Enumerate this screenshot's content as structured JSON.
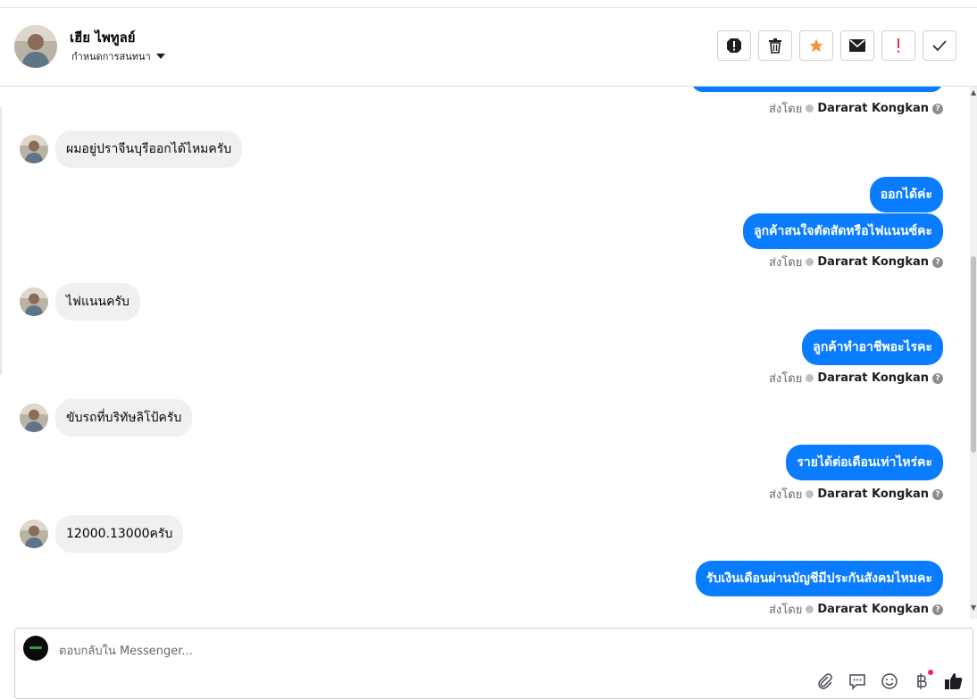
{
  "header": {
    "name": "เฮีย ไพทูลย์",
    "assign_label": "กำหนดการสนทนา",
    "actions": [
      "spam-alert-icon",
      "trash-icon",
      "star-icon",
      "envelope-icon",
      "important-icon",
      "check-icon"
    ]
  },
  "colors": {
    "accent": "#0a7cff",
    "star": "#f7923a",
    "important": "#f02849"
  },
  "messages": {
    "in1": "ผมอยู่ปราจีนบุรีออกได้ไหมครับ",
    "in2": "ไฟแนนครับ",
    "in3": "ขับรถที่บริทัษลิโป้ครับ",
    "in4": "12000.13000ครับ",
    "out1": "ออกได้ค่ะ",
    "out2": "ลูกค้าสนใจตัดสัดหรือไฟแนนซ์คะ",
    "out3": "ลูกค้าทำอาชีพอะไรคะ",
    "out4": "รายได้ต่อเดือนเท่าไหร่คะ",
    "out5": "รับเงินเดือนผ่านบัญชีมีประกันสังคมไหมคะ"
  },
  "meta": {
    "sent_by": "ส่งโดย",
    "agent": "Dararat Kongkan"
  },
  "composer": {
    "placeholder": "ตอบกลับใน Messenger..."
  }
}
